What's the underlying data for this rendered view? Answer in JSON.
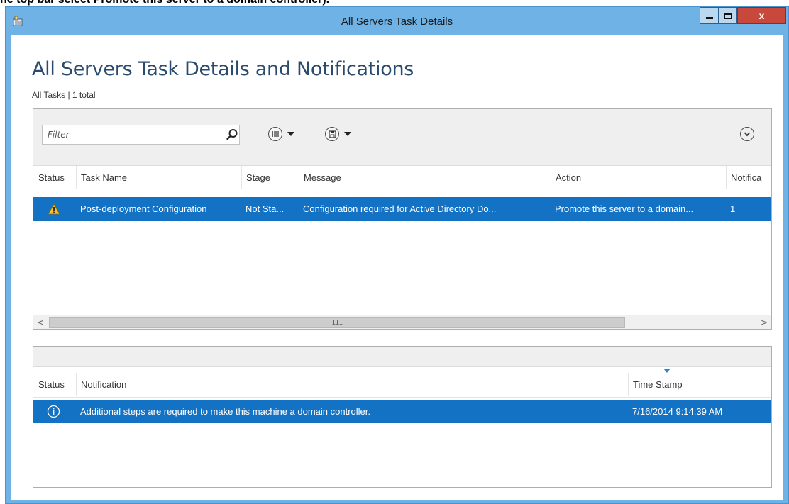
{
  "document_caption": "he top bar select Promote this server to a domain controller).",
  "window": {
    "title": "All Servers Task Details",
    "min_label": "minimize",
    "max_label": "maximize",
    "close_label": "x"
  },
  "page": {
    "title": "All Servers Task Details and Notifications",
    "summary": "All Tasks | 1 total"
  },
  "tasks": {
    "filter_placeholder": "Filter",
    "columns": [
      "Status",
      "Task Name",
      "Stage",
      "Message",
      "Action",
      "Notifica"
    ],
    "rows": [
      {
        "status_icon": "warning-icon",
        "task_name": "Post-deployment Configuration",
        "stage": "Not Sta...",
        "message": "Configuration required for Active Directory Do...",
        "action": "Promote this server to a domain...",
        "notifications": "1"
      }
    ],
    "scroll_left": "<",
    "scroll_right": ">",
    "scroll_grip": "III"
  },
  "notifications": {
    "columns": [
      "Status",
      "Notification",
      "Time Stamp"
    ],
    "rows": [
      {
        "status_icon": "info-icon",
        "notification": "Additional steps are required to make this machine a domain controller.",
        "timestamp": "7/16/2014 9:14:39 AM"
      }
    ]
  },
  "colors": {
    "window_frame": "#6fb2e5",
    "selection": "#1472c4",
    "close_button": "#c9483c",
    "title_text": "#2a4a6e"
  }
}
